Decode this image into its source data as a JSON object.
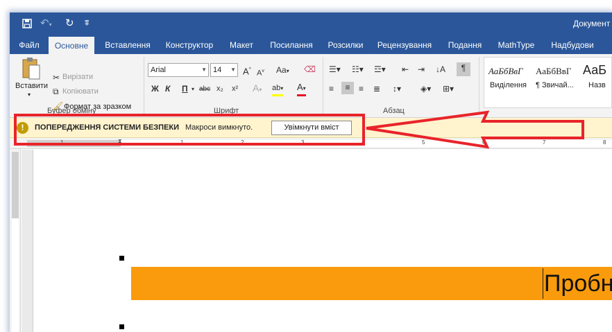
{
  "titlebar": {
    "doc_title": "Документ",
    "qat": {
      "save_icon": "save-icon",
      "undo_icon": "undo-icon",
      "redo_icon": "redo-icon",
      "customize_icon": "customize-qat-icon"
    },
    "color": "#2b579a"
  },
  "tabs": [
    "Файл",
    "Основне",
    "Вставлення",
    "Конструктор",
    "Макет",
    "Посилання",
    "Розсилки",
    "Рецензування",
    "Подання",
    "MathType",
    "Надбудови"
  ],
  "active_tab": "Основне",
  "ribbon": {
    "clipboard": {
      "paste_label": "Вставити",
      "cut_label": "Вирізати",
      "copy_label": "Копіювати",
      "format_painter_label": "Формат за зразком",
      "group_label": "Буфер обміну"
    },
    "font": {
      "font_name": "Arial",
      "font_size": "14",
      "grow_label": "A",
      "shrink_label": "A",
      "case_label": "Aa",
      "bold": "Ж",
      "italic": "К",
      "underline": "П",
      "strike": "abc",
      "subscript": "x₂",
      "superscript": "x²",
      "effects_label": "A",
      "highlight_label": "ab",
      "font_color_label": "A",
      "group_label": "Шрифт"
    },
    "paragraph": {
      "group_label": "Абзац"
    },
    "styles": {
      "items": [
        {
          "sample": "АаБбВвГ",
          "name": "Виділення"
        },
        {
          "sample": "АаБбВвГ",
          "name": "¶ Звичай..."
        },
        {
          "sample": "АаБ",
          "name": "Назв"
        }
      ]
    }
  },
  "security_bar": {
    "title": "ПОПЕРЕДЖЕННЯ СИСТЕМИ БЕЗПЕКИ",
    "message": "Макроси вимкнуто.",
    "button_label": "Увімкнути вміст",
    "warning_icon": "!",
    "background": "#fff4ce"
  },
  "ruler": {
    "numbers": [
      "1",
      "1",
      "2",
      "3",
      "4",
      "5",
      "6",
      "7",
      "8"
    ]
  },
  "document": {
    "text": "Пробн",
    "highlight_color": "#f99b0c"
  },
  "annotation": {
    "color": "#e8242a"
  }
}
